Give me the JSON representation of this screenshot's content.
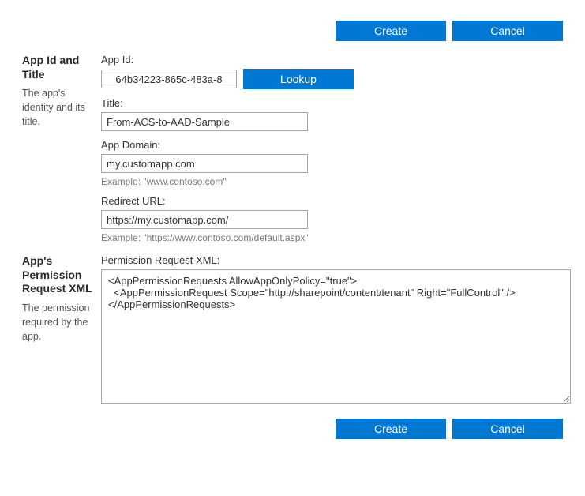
{
  "buttons": {
    "create": "Create",
    "cancel": "Cancel",
    "lookup": "Lookup"
  },
  "section1": {
    "title": "App Id and Title",
    "desc": "The app's identity and its title.",
    "appIdLabel": "App Id:",
    "appIdValue": "64b34223-865c-483a-8",
    "titleLabel": "Title:",
    "titleValue": "From-ACS-to-AAD-Sample",
    "domainLabel": "App Domain:",
    "domainValue": "my.customapp.com",
    "domainHint": "Example: \"www.contoso.com\"",
    "redirectLabel": "Redirect URL:",
    "redirectValue": "https://my.customapp.com/",
    "redirectHint": "Example: \"https://www.contoso.com/default.aspx\""
  },
  "section2": {
    "title": "App's Permission Request XML",
    "desc": "The permission required by the app.",
    "xmlLabel": "Permission Request XML:",
    "xmlValue": "<AppPermissionRequests AllowAppOnlyPolicy=\"true\">\n  <AppPermissionRequest Scope=\"http://sharepoint/content/tenant\" Right=\"FullControl\" />\n</AppPermissionRequests>"
  }
}
